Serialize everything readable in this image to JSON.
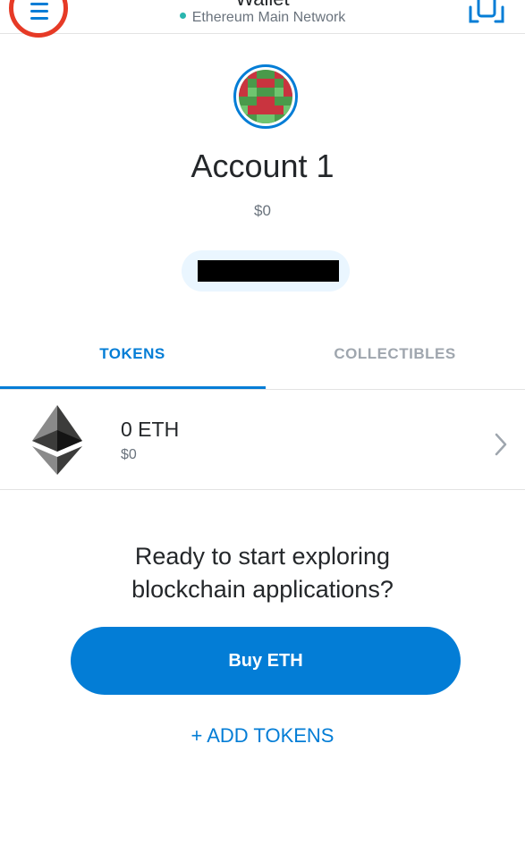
{
  "header": {
    "title": "Wallet",
    "network": "Ethereum Main Network",
    "menu_icon": "hamburger-menu-icon",
    "scan_icon": "qr-scan-icon",
    "network_dot_color": "#29b6af"
  },
  "account": {
    "name": "Account 1",
    "balance": "$0"
  },
  "tabs": [
    {
      "label": "TOKENS",
      "active": true
    },
    {
      "label": "COLLECTIBLES",
      "active": false
    }
  ],
  "tokens": [
    {
      "amount": "0 ETH",
      "fiat": "$0",
      "icon": "ethereum-icon"
    }
  ],
  "empty_state": {
    "prompt_line1": "Ready to start exploring",
    "prompt_line2": "blockchain applications?",
    "buy_label": "Buy ETH",
    "add_tokens_label": "+ ADD TOKENS"
  },
  "colors": {
    "accent": "#037dd6",
    "highlight_circle": "#e63a26"
  }
}
